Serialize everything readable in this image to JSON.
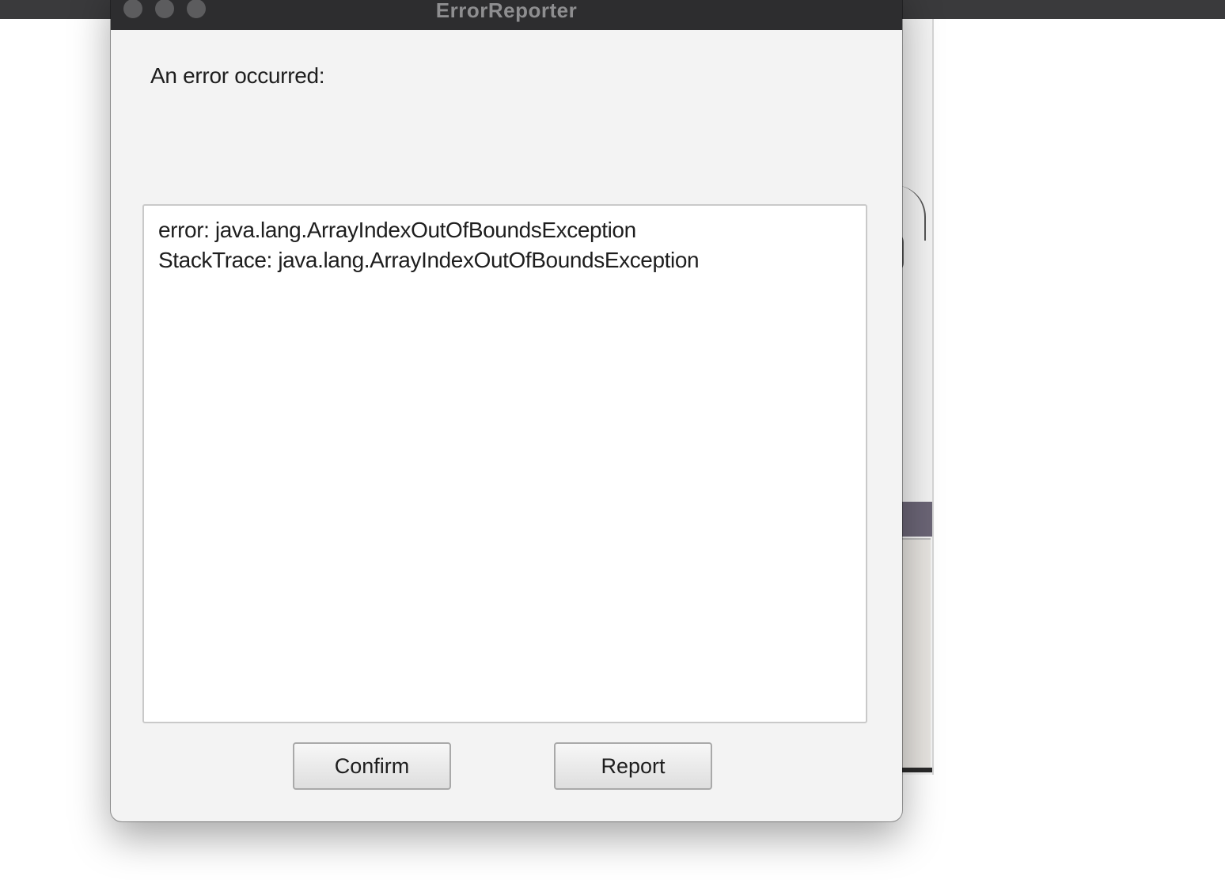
{
  "window": {
    "title": "ErrorReporter"
  },
  "dialog": {
    "message": "An error occurred:",
    "details_lines": [
      "error: java.lang.ArrayIndexOutOfBoundsException",
      "StackTrace: java.lang.ArrayIndexOutOfBoundsException"
    ]
  },
  "buttons": {
    "confirm_label": "Confirm",
    "report_label": "Report"
  },
  "colors": {
    "titlebar": "#2d2d2f",
    "window_background": "#f3f3f3",
    "text": "#1e1e1e"
  }
}
